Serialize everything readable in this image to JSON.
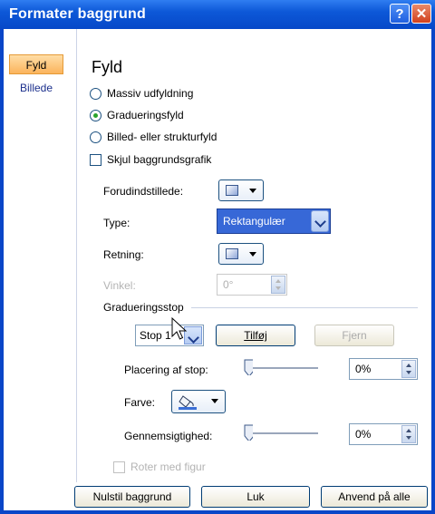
{
  "window": {
    "title": "Formater baggrund",
    "help_label": "?",
    "close_label": "✕"
  },
  "sidebar": {
    "items": [
      {
        "label": "Fyld",
        "active": true
      },
      {
        "label": "Billede",
        "active": false
      }
    ]
  },
  "fill": {
    "section_title": "Fyld",
    "options": [
      {
        "label": "Massiv udfyldning",
        "checked": false
      },
      {
        "label": "Gradueringsfyld",
        "checked": true
      },
      {
        "label": "Billed- eller strukturfyld",
        "checked": false
      }
    ],
    "hide_bg_graphics": {
      "label": "Skjul baggrundsgrafik",
      "checked": false
    },
    "preset_label": "Forudindstillede:",
    "type_label": "Type:",
    "type_value": "Rektangulær",
    "direction_label": "Retning:",
    "angle_label": "Vinkel:",
    "angle_value": "0°",
    "stops_label": "Gradueringsstop",
    "stop_value": "Stop 1",
    "add_button": "Tilføj",
    "remove_button": "Fjern",
    "position_label": "Placering af stop:",
    "position_value": "0%",
    "position_level": 0,
    "color_label": "Farve:",
    "transparency_label": "Gennemsigtighed:",
    "transparency_value": "0%",
    "transparency_level": 0,
    "rotate_label": "Roter med figur"
  },
  "footer": {
    "reset": "Nulstil baggrund",
    "close": "Luk",
    "apply_all": "Anvend på alle"
  },
  "colors": {
    "titlebar": "#0648c8",
    "select_blue": "#3768d7",
    "active_tab": "#fbb45c"
  }
}
